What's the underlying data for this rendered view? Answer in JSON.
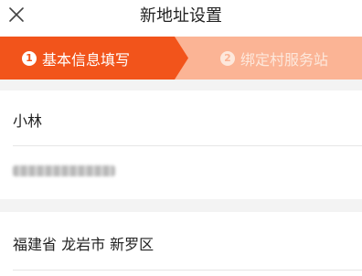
{
  "header": {
    "title": "新地址设置",
    "close_icon": "close-icon"
  },
  "steps": [
    {
      "number": "1",
      "label": "基本信息填写",
      "active": true
    },
    {
      "number": "2",
      "label": "绑定村服务站",
      "active": false
    }
  ],
  "form": {
    "name": "小林",
    "region": "福建省 龙岩市 新罗区"
  },
  "colors": {
    "accent": "#f2541b",
    "inactive_step_bg": "#fbb495",
    "section_gap": "#f3f3f3"
  }
}
